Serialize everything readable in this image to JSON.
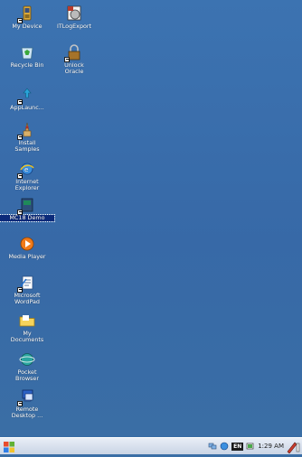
{
  "desktop": {
    "icons": [
      {
        "label": "My Device",
        "icon": "my-device-icon"
      },
      {
        "label": "ITLogExport",
        "icon": "itlogexport-icon"
      },
      {
        "label": "Recycle Bin",
        "icon": "recycle-bin-icon"
      },
      {
        "label": "Unlock\nOracle",
        "icon": "unlock-oracle-icon"
      },
      {
        "label": "AppLaunc...",
        "icon": "applauncher-icon"
      },
      {
        "label": "Install\nSamples",
        "icon": "install-samples-icon"
      },
      {
        "label": "Internet\nExplorer",
        "icon": "internet-explorer-icon"
      },
      {
        "label": "MC18 Demo",
        "icon": "mc18-demo-icon"
      },
      {
        "label": "Media Player",
        "icon": "media-player-icon"
      },
      {
        "label": "Microsoft\nWordPad",
        "icon": "wordpad-icon"
      },
      {
        "label": "My\nDocuments",
        "icon": "my-documents-icon"
      },
      {
        "label": "Pocket\nBrowser",
        "icon": "pocket-browser-icon"
      },
      {
        "label": "Remote\nDesktop ...",
        "icon": "remote-desktop-icon"
      }
    ]
  },
  "taskbar": {
    "language": "EN",
    "time": "1:29 AM"
  }
}
